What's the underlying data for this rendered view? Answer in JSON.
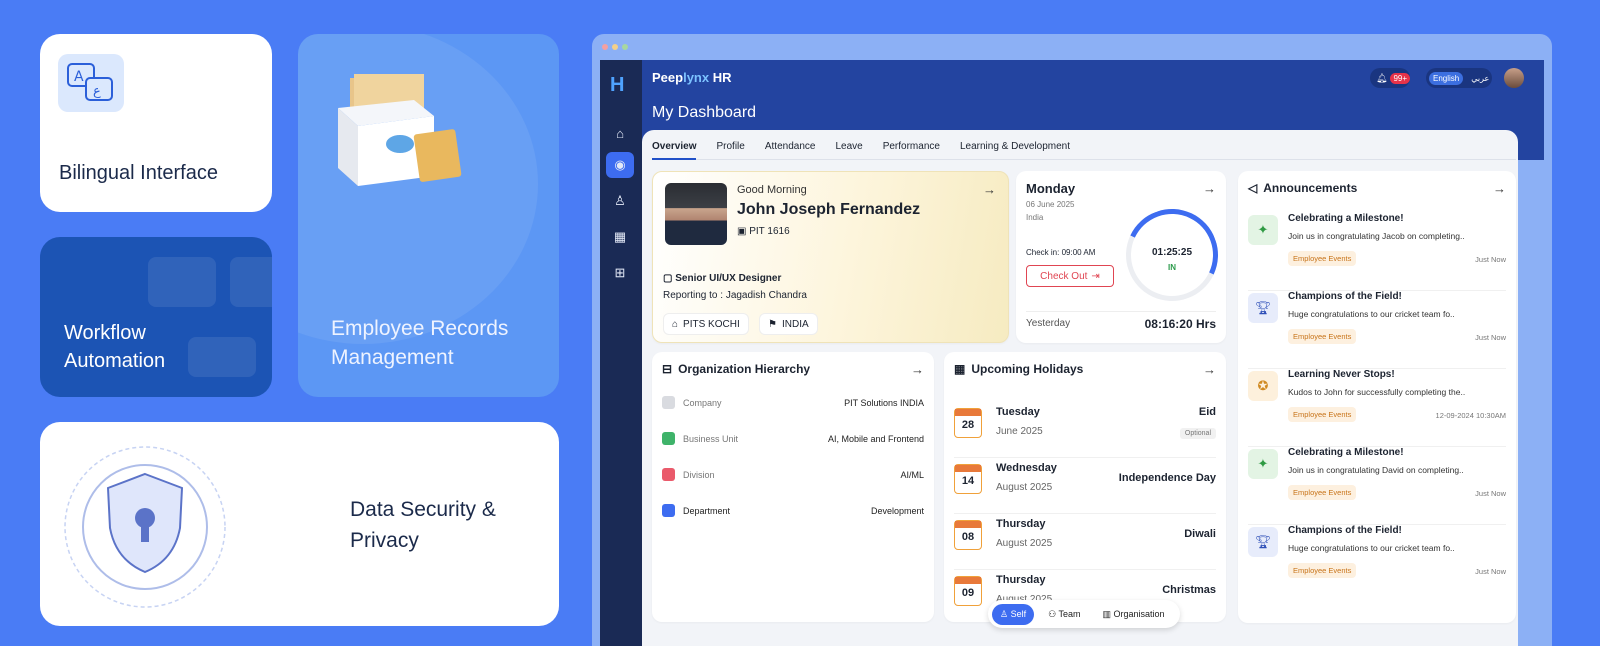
{
  "features": {
    "bilingual": "Bilingual Interface",
    "workflow": "Workflow Automation",
    "records": "Employee Records Management",
    "security": "Data Security & Privacy"
  },
  "app": {
    "brand_a": "Peep",
    "brand_b": "lynx",
    "brand_c": " HR",
    "page_title": "My Dashboard",
    "notif_count": "99+",
    "lang_en": "English",
    "lang_ar": "عربي"
  },
  "tabs": [
    "Overview",
    "Profile",
    "Attendance",
    "Leave",
    "Performance",
    "Learning & Development"
  ],
  "profile": {
    "greeting": "Good Morning",
    "name": "John Joseph  Fernandez",
    "id": "PIT 1616",
    "role": "Senior UI/UX Designer",
    "reporting": "Reporting to : Jagadish Chandra",
    "location": "PITS KOCHI",
    "country": "INDIA"
  },
  "attendance": {
    "day": "Monday",
    "date": "06 June 2025",
    "country": "India",
    "check_in": "Check in: 09:00 AM",
    "checkout_label": "Check Out",
    "timer": "01:25:25",
    "status": "IN",
    "progress": 0.28,
    "yesterday_label": "Yesterday",
    "yesterday_value": "08:16:20 Hrs"
  },
  "announcements": {
    "title": "Announcements",
    "items": [
      {
        "title": "Celebrating a Milestone!",
        "desc": "Join us in congratulating Jacob on completing..",
        "badge": "Employee Events",
        "when": "Just Now"
      },
      {
        "title": "Champions of the Field!",
        "desc": "Huge congratulations to our cricket team fo..",
        "badge": "Employee Events",
        "when": "Just Now"
      },
      {
        "title": "Learning Never Stops!",
        "desc": "Kudos to John for successfully completing the..",
        "badge": "Employee Events",
        "when": "12-09-2024 10:30AM"
      },
      {
        "title": "Celebrating a Milestone!",
        "desc": "Join us in congratulating David on completing..",
        "badge": "Employee Events",
        "when": "Just Now"
      },
      {
        "title": "Champions of the Field!",
        "desc": "Huge congratulations to our cricket team fo..",
        "badge": "Employee Events",
        "when": "Just Now"
      }
    ]
  },
  "org": {
    "title": "Organization Hierarchy",
    "rows": [
      {
        "label": "Company",
        "value": "PIT Solutions INDIA"
      },
      {
        "label": "Business Unit",
        "value": "AI, Mobile and Frontend"
      },
      {
        "label": "Division",
        "value": "AI/ML"
      },
      {
        "label": "Department",
        "value": "Development"
      }
    ]
  },
  "holidays": {
    "title": "Upcoming Holidays",
    "items": [
      {
        "num": "28",
        "day": "Tuesday",
        "month": "June 2025",
        "name": "Eid",
        "optional": "Optional"
      },
      {
        "num": "14",
        "day": "Wednesday",
        "month": "August 2025",
        "name": "Independence Day"
      },
      {
        "num": "08",
        "day": "Thursday",
        "month": "August 2025",
        "name": "Diwali"
      },
      {
        "num": "09",
        "day": "Thursday",
        "month": "August 2025",
        "name": "Christmas"
      }
    ]
  },
  "bottom_nav": [
    "Self",
    "Team",
    "Organisation"
  ]
}
